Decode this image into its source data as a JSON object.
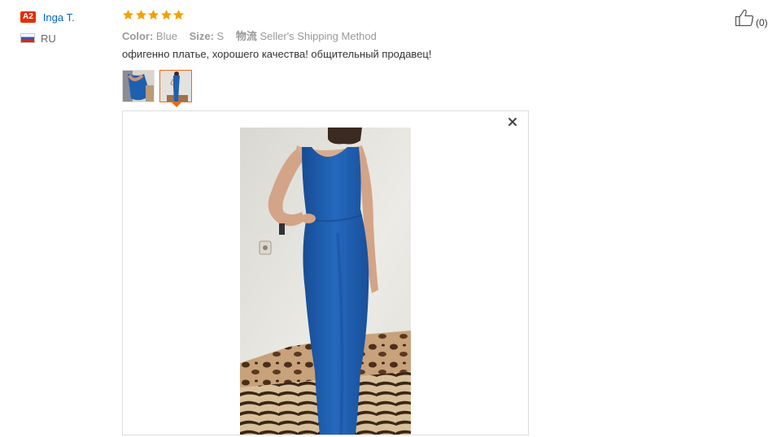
{
  "user": {
    "level_badge": "A2",
    "name": "Inga T.",
    "country_code": "RU",
    "flag_icon": "russia-flag-icon"
  },
  "rating": {
    "stars": 5,
    "max": 5,
    "star_color": "#f5a100"
  },
  "attributes": [
    {
      "label": "Color:",
      "value": "Blue"
    },
    {
      "label": "Size:",
      "value": "S"
    },
    {
      "label": "物流",
      "value": "Seller's Shipping Method"
    }
  ],
  "review_text": "офигенно платье, хорошего качества! общительный продавец!",
  "photos": {
    "thumbnails": [
      {
        "name": "photo-thumb-1",
        "active": false
      },
      {
        "name": "photo-thumb-2",
        "active": true
      }
    ],
    "close_icon": "close-icon"
  },
  "helpful": {
    "icon": "thumbs-up-icon",
    "count": "(0)"
  },
  "colors": {
    "accent": "#e96a1c",
    "link": "#0066cc",
    "badge": "#e62e04",
    "dress_blue": "#1f5fb0"
  }
}
